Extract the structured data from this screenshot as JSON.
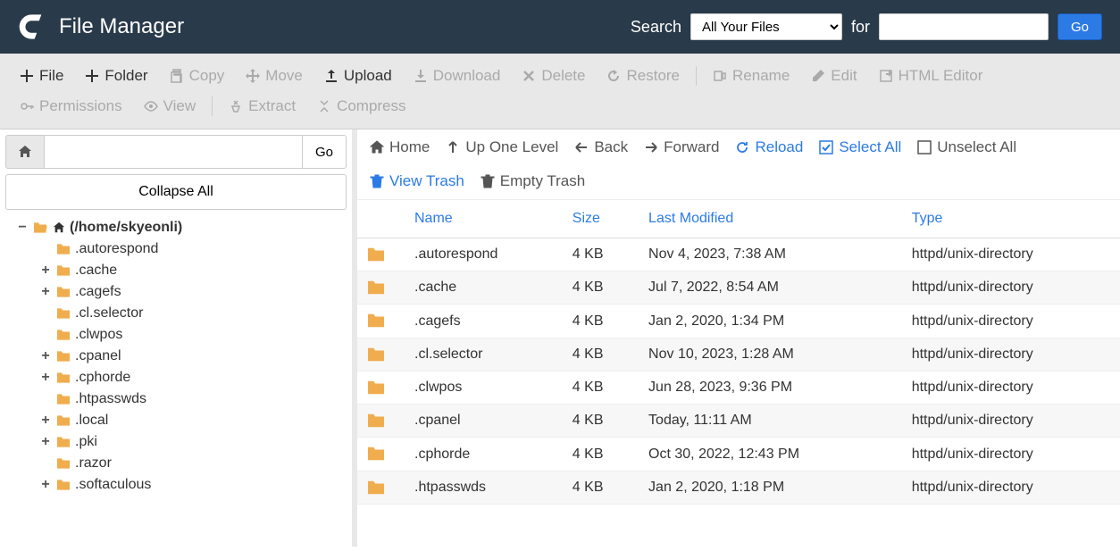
{
  "header": {
    "app_title": "File Manager",
    "search_label": "Search",
    "search_select_value": "All Your Files",
    "for_label": "for",
    "search_input_value": "",
    "go_label": "Go"
  },
  "toolbar": {
    "items": [
      {
        "label": "File",
        "icon": "plus",
        "enabled": true
      },
      {
        "label": "Folder",
        "icon": "plus",
        "enabled": true
      },
      {
        "label": "Copy",
        "icon": "copy",
        "enabled": false
      },
      {
        "label": "Move",
        "icon": "move",
        "enabled": false
      },
      {
        "label": "Upload",
        "icon": "upload",
        "enabled": true
      },
      {
        "label": "Download",
        "icon": "download",
        "enabled": false
      },
      {
        "label": "Delete",
        "icon": "delete",
        "enabled": false
      },
      {
        "label": "Restore",
        "icon": "restore",
        "enabled": false
      },
      {
        "sep": true
      },
      {
        "label": "Rename",
        "icon": "rename",
        "enabled": false
      },
      {
        "label": "Edit",
        "icon": "edit",
        "enabled": false
      },
      {
        "label": "HTML Editor",
        "icon": "html",
        "enabled": false
      },
      {
        "label": "Permissions",
        "icon": "key",
        "enabled": false
      },
      {
        "label": "View",
        "icon": "eye",
        "enabled": false
      },
      {
        "sep": true
      },
      {
        "label": "Extract",
        "icon": "extract",
        "enabled": false
      },
      {
        "label": "Compress",
        "icon": "compress",
        "enabled": false
      }
    ]
  },
  "sidebar": {
    "path_input_value": "",
    "go_label": "Go",
    "collapse_label": "Collapse All",
    "root_label": "(/home/skyeonli)",
    "tree": [
      {
        "label": ".autorespond",
        "expandable": false
      },
      {
        "label": ".cache",
        "expandable": true
      },
      {
        "label": ".cagefs",
        "expandable": true
      },
      {
        "label": ".cl.selector",
        "expandable": false
      },
      {
        "label": ".clwpos",
        "expandable": false
      },
      {
        "label": ".cpanel",
        "expandable": true
      },
      {
        "label": ".cphorde",
        "expandable": true
      },
      {
        "label": ".htpasswds",
        "expandable": false
      },
      {
        "label": ".local",
        "expandable": true
      },
      {
        "label": ".pki",
        "expandable": true
      },
      {
        "label": ".razor",
        "expandable": false
      },
      {
        "label": ".softaculous",
        "expandable": true
      }
    ]
  },
  "breadcrumb": {
    "items": [
      {
        "label": "Home",
        "icon": "home",
        "style": "gray"
      },
      {
        "label": "Up One Level",
        "icon": "up",
        "style": "gray"
      },
      {
        "label": "Back",
        "icon": "back",
        "style": "gray"
      },
      {
        "label": "Forward",
        "icon": "forward",
        "style": "gray"
      },
      {
        "label": "Reload",
        "icon": "reload",
        "style": "blue"
      },
      {
        "label": "Select All",
        "icon": "checkbox-checked",
        "style": "blue"
      },
      {
        "label": "Unselect All",
        "icon": "checkbox",
        "style": "gray"
      },
      {
        "label": "View Trash",
        "icon": "trash",
        "style": "blue"
      },
      {
        "label": "Empty Trash",
        "icon": "trash",
        "style": "gray"
      }
    ]
  },
  "table": {
    "columns": [
      "Name",
      "Size",
      "Last Modified",
      "Type"
    ],
    "rows": [
      {
        "name": ".autorespond",
        "size": "4 KB",
        "modified": "Nov 4, 2023, 7:38 AM",
        "type": "httpd/unix-directory"
      },
      {
        "name": ".cache",
        "size": "4 KB",
        "modified": "Jul 7, 2022, 8:54 AM",
        "type": "httpd/unix-directory"
      },
      {
        "name": ".cagefs",
        "size": "4 KB",
        "modified": "Jan 2, 2020, 1:34 PM",
        "type": "httpd/unix-directory"
      },
      {
        "name": ".cl.selector",
        "size": "4 KB",
        "modified": "Nov 10, 2023, 1:28 AM",
        "type": "httpd/unix-directory"
      },
      {
        "name": ".clwpos",
        "size": "4 KB",
        "modified": "Jun 28, 2023, 9:36 PM",
        "type": "httpd/unix-directory"
      },
      {
        "name": ".cpanel",
        "size": "4 KB",
        "modified": "Today, 11:11 AM",
        "type": "httpd/unix-directory"
      },
      {
        "name": ".cphorde",
        "size": "4 KB",
        "modified": "Oct 30, 2022, 12:43 PM",
        "type": "httpd/unix-directory"
      },
      {
        "name": ".htpasswds",
        "size": "4 KB",
        "modified": "Jan 2, 2020, 1:18 PM",
        "type": "httpd/unix-directory"
      }
    ]
  }
}
